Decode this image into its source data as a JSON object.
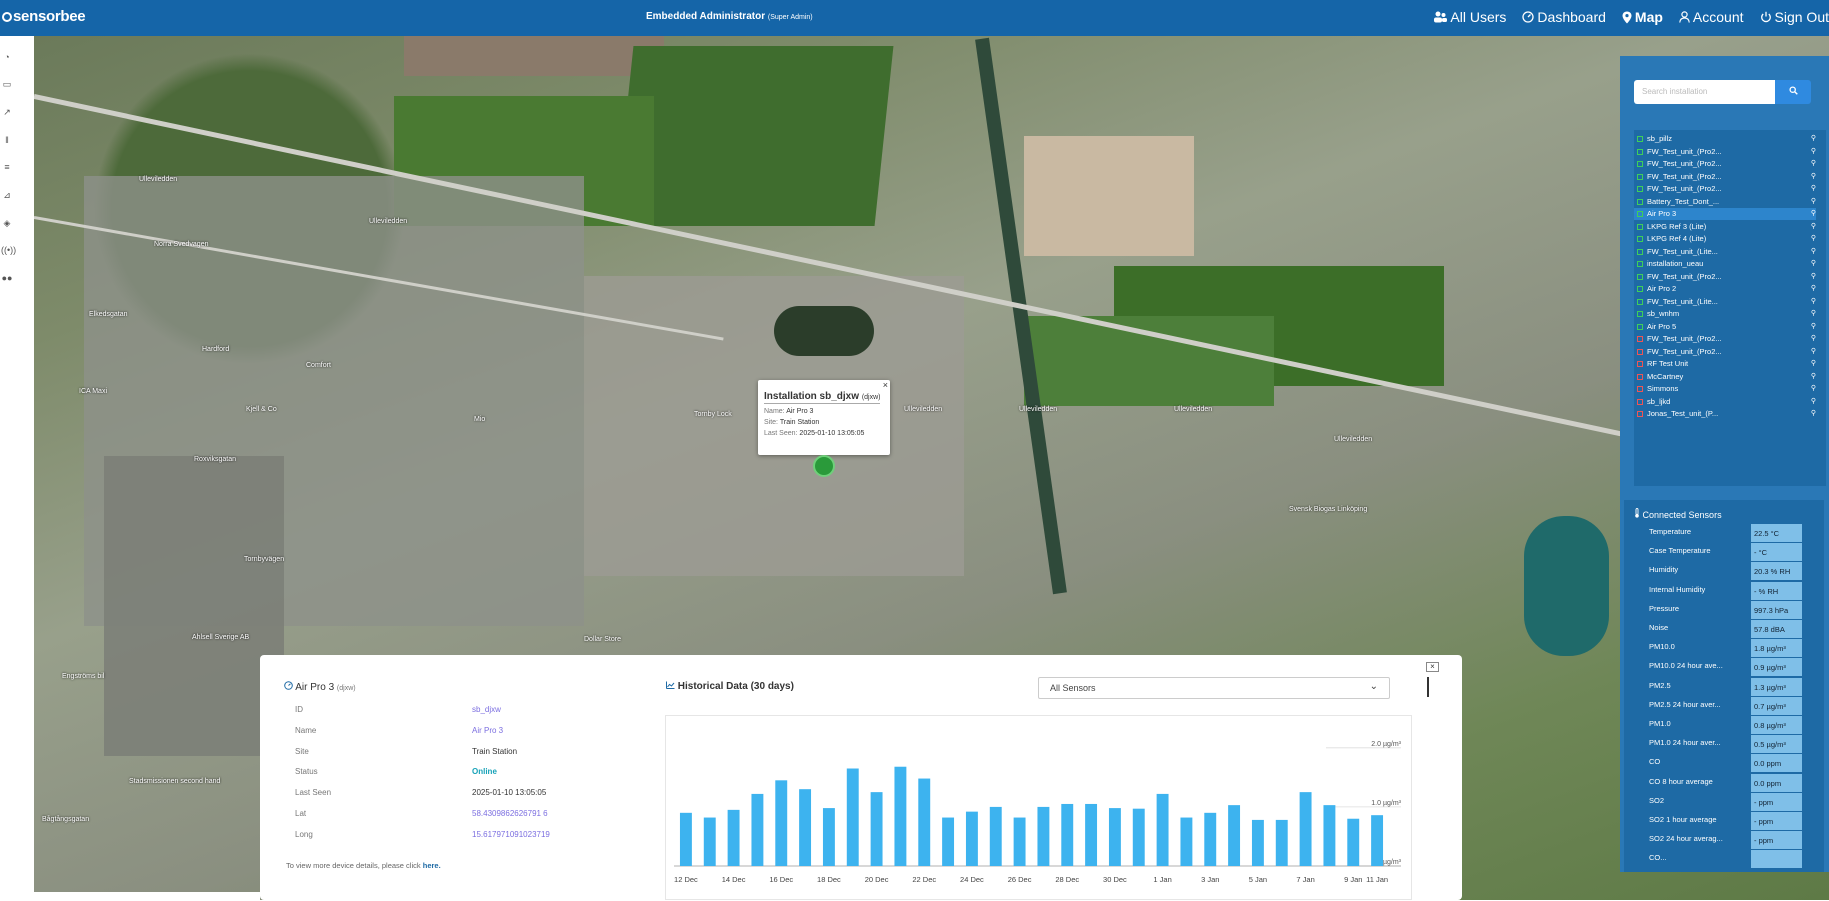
{
  "app": {
    "logo_text": "sensorbee",
    "admin_title": "Embedded Administrator",
    "admin_role": "(Super Admin)"
  },
  "nav": {
    "all_users": "All Users",
    "dashboard": "Dashboard",
    "map": "Map",
    "account": "Account",
    "sign_out": "Sign Out"
  },
  "sidebar_icons": [
    "dashboard-icon",
    "monitor-icon",
    "chart-icon",
    "barcode-icon",
    "bars-icon",
    "analytics-icon",
    "cube-icon",
    "signal-icon",
    "users-icon"
  ],
  "map": {
    "popup": {
      "title": "Installation sb_djxw",
      "title_id": "(djxw)",
      "name_label": "Name:",
      "name_value": "Air Pro 3",
      "site_label": "Site:",
      "site_value": "Train Station",
      "last_label": "Last Seen:",
      "last_value": "2025-01-10 13:05:05",
      "close": "×"
    },
    "labels": [
      "Ulleviledden",
      "Ulleviledden",
      "Norra Svedvagen",
      "Comfort",
      "Hardford",
      "ICA Maxi",
      "Tornbyvägen",
      "Roxviksgatan",
      "Ulleviledden",
      "Ulleviledden",
      "Ulleviledden",
      "Ulleviledden",
      "Svensk Biogas Linköping",
      "Tornby Lock",
      "Mio",
      "Kjell & Co",
      "Ahlsell Sverige AB",
      "Dollar Store",
      "Stadsmissionen second hand",
      "Engströms bil",
      "Elkedsgatan",
      "Bågtångsgatan"
    ]
  },
  "right_panel": {
    "search_placeholder": "Search installation",
    "search_icon": "search-icon",
    "installations": [
      {
        "name": "sb_pillz",
        "online": true
      },
      {
        "name": "FW_Test_unit_(Pro2...",
        "online": true
      },
      {
        "name": "FW_Test_unit_(Pro2...",
        "online": true
      },
      {
        "name": "FW_Test_unit_(Pro2...",
        "online": true
      },
      {
        "name": "FW_Test_unit_(Pro2...",
        "online": true
      },
      {
        "name": "Battery_Test_Dont_...",
        "online": true
      },
      {
        "name": "Air Pro 3",
        "online": true,
        "selected": true
      },
      {
        "name": "LKPG Ref 3 (Lite)",
        "online": true
      },
      {
        "name": "LKPG Ref 4 (Lite)",
        "online": true
      },
      {
        "name": "FW_Test_unit_(Lite...",
        "online": true
      },
      {
        "name": "installation_ueau",
        "online": true
      },
      {
        "name": "FW_Test_unit_(Pro2...",
        "online": true
      },
      {
        "name": "Air Pro 2",
        "online": true
      },
      {
        "name": "FW_Test_unit_(Lite...",
        "online": true
      },
      {
        "name": "sb_wnhm",
        "online": true
      },
      {
        "name": "Air Pro 5",
        "online": true
      },
      {
        "name": "FW_Test_unit_(Pro2...",
        "online": false
      },
      {
        "name": "FW_Test_unit_(Pro2...",
        "online": false
      },
      {
        "name": "RF Test Unit",
        "online": false
      },
      {
        "name": "McCartney",
        "online": false
      },
      {
        "name": "Simmons",
        "online": false
      },
      {
        "name": "sb_ljkd",
        "online": false
      },
      {
        "name": "Jonas_Test_unit_(P...",
        "online": false
      }
    ],
    "sensors_title": "Connected Sensors",
    "sensors": [
      {
        "label": "Temperature",
        "value": "22.5 °C"
      },
      {
        "label": "Case Temperature",
        "value": "- °C"
      },
      {
        "label": "Humidity",
        "value": "20.3 % RH"
      },
      {
        "label": "Internal Humidity",
        "value": "- % RH"
      },
      {
        "label": "Pressure",
        "value": "997.3 hPa"
      },
      {
        "label": "Noise",
        "value": "57.8 dBA"
      },
      {
        "label": "PM10.0",
        "value": "1.8 µg/m³"
      },
      {
        "label": "PM10.0 24 hour ave...",
        "value": "0.9 µg/m³"
      },
      {
        "label": "PM2.5",
        "value": "1.3 µg/m³"
      },
      {
        "label": "PM2.5 24 hour aver...",
        "value": "0.7 µg/m³"
      },
      {
        "label": "PM1.0",
        "value": "0.8 µg/m³"
      },
      {
        "label": "PM1.0 24 hour aver...",
        "value": "0.5 µg/m³"
      },
      {
        "label": "CO",
        "value": "0.0 ppm"
      },
      {
        "label": "CO 8 hour average",
        "value": "0.0 ppm"
      },
      {
        "label": "SO2",
        "value": "- ppm"
      },
      {
        "label": "SO2 1 hour average",
        "value": "- ppm"
      },
      {
        "label": "SO2 24 hour averag...",
        "value": "- ppm"
      },
      {
        "label": "CO...",
        "value": ""
      }
    ]
  },
  "details": {
    "title": "Air Pro 3",
    "title_id": "(djxw)",
    "rows": [
      {
        "label": "ID",
        "value": "sb_djxw",
        "style": "link"
      },
      {
        "label": "Name",
        "value": "Air Pro 3",
        "style": "link"
      },
      {
        "label": "Site",
        "value": "Train Station",
        "style": "plain"
      },
      {
        "label": "Status",
        "value": "Online",
        "style": "online"
      },
      {
        "label": "Last Seen",
        "value": "2025-01-10 13:05:05",
        "style": "plain"
      },
      {
        "label": "Lat",
        "value": "58.4309862626791 6",
        "style": "link"
      },
      {
        "label": "Long",
        "value": "15.617971091023719",
        "style": "link"
      }
    ],
    "more_text": "To view more device details, please click",
    "more_link": "here.",
    "close": "×"
  },
  "history": {
    "title": "Historical Data (30 days)",
    "select_value": "All Sensors",
    "chevron": "⌄"
  },
  "chart_data": {
    "type": "bar",
    "title": "",
    "xlabel": "",
    "ylabel": "",
    "ylim": [
      0,
      2.2
    ],
    "y_ticks": [
      {
        "value": 2.0,
        "label": "2.0 µg/m³"
      },
      {
        "value": 1.0,
        "label": "1.0 µg/m³"
      },
      {
        "value": 0.0,
        "label": "0.0 µg/m³"
      }
    ],
    "x_tick_labels": [
      "12 Dec",
      "14 Dec",
      "16 Dec",
      "18 Dec",
      "20 Dec",
      "22 Dec",
      "24 Dec",
      "26 Dec",
      "28 Dec",
      "30 Dec",
      "1 Jan",
      "3 Jan",
      "5 Jan",
      "7 Jan",
      "9 Jan",
      "11 Jan"
    ],
    "values": [
      0.9,
      0.82,
      0.95,
      1.22,
      1.45,
      1.3,
      0.98,
      1.65,
      1.25,
      1.68,
      1.48,
      0.82,
      0.92,
      1.0,
      0.82,
      1.0,
      1.05,
      1.05,
      0.98,
      0.97,
      1.22,
      0.82,
      0.9,
      1.03,
      0.78,
      0.78,
      1.25,
      1.03,
      0.8,
      0.86
    ],
    "bar_color": "#3db3ef",
    "grid": false
  }
}
